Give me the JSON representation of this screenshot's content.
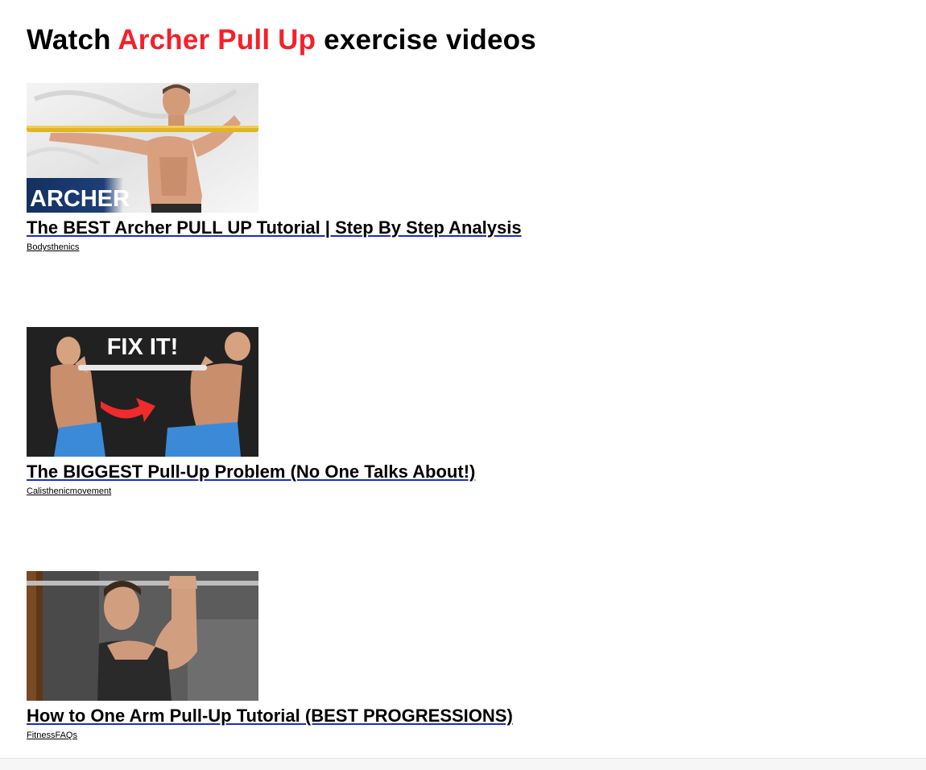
{
  "heading": {
    "prefix": "Watch ",
    "exercise": "Archer Pull Up",
    "suffix": " exercise videos"
  },
  "colors": {
    "accent": "#f5202b",
    "link_underline": "#1a2dc8"
  },
  "videos": [
    {
      "title": "The BEST Archer PULL UP Tutorial | Step By Step Analysis",
      "channel": "Bodysthenics",
      "thumb_text": "ARCHER"
    },
    {
      "title": "The BIGGEST Pull-Up Problem (No One Talks About!)",
      "channel": "Calisthenicmovement",
      "thumb_text": "FIX IT!"
    },
    {
      "title": "How to One Arm Pull-Up Tutorial (BEST PROGRESSIONS)",
      "channel": "FitnessFAQs",
      "thumb_text": ""
    }
  ]
}
